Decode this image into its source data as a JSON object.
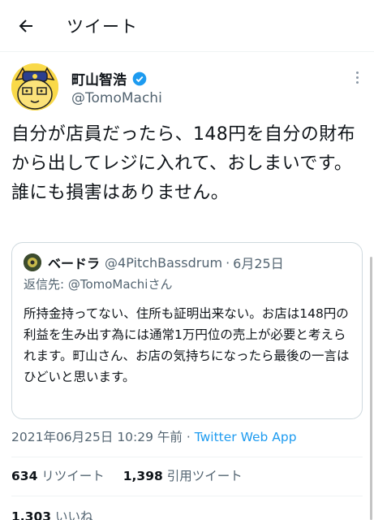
{
  "header": {
    "title": "ツイート",
    "back_icon": "arrow-left-icon"
  },
  "author": {
    "name": "町山智浩",
    "handle": "@TomoMachi",
    "verified_icon": "verified-badge-icon",
    "more_icon": "more-vertical-icon"
  },
  "tweet": {
    "text": "自分が店員だったら、148円を自分の財布から出してレジに入れて、おしまいです。誰にも損害はありません。"
  },
  "quote": {
    "name": "ベードラ",
    "handle": "@4PitchBassdrum",
    "dot": "·",
    "date": "6月25日",
    "reply_prefix": "返信先: ",
    "reply_mention": "@TomoMachiさん",
    "body": "所持金持ってない、住所も証明出来ない。お店は148円の利益を生み出す為には通常1万円位の売上が必要と考えられます。町山さん、お店の気持ちになったら最後の一言はひどいと思います。"
  },
  "meta": {
    "timestamp": "2021年06月25日 10:29 午前",
    "dot": " · ",
    "app": "Twitter Web App"
  },
  "stats": {
    "retweets": "634",
    "retweets_label": "リツイート",
    "quotes": "1,398",
    "quotes_label": "引用ツイート",
    "likes": "1,303",
    "likes_label": "いいね"
  },
  "colors": {
    "accent": "#1d9bf0",
    "secondary_text": "#536471",
    "border": "#cfd9de"
  }
}
